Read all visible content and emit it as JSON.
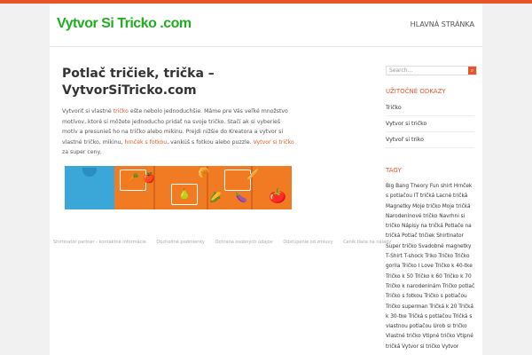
{
  "header": {
    "logo": "Vytvor Si Tricko .com",
    "nav_home": "HLAVNÁ STRÁNKA"
  },
  "main": {
    "title": "Potlač tričiek, trička – VytvorSiTricko.com",
    "paragraph": {
      "t1": "Vytvoriť si vlastné ",
      "l1": "tričko",
      "t2": " ešte nebolo jednoduchšie. Máme pre Vás veľké množstvo motívov, ktoré si môžete jednoducho pridať na svoje tričko. Stačí ak si vyberieš motív a presunieš ho na tričko alebo mikinu. Prejdi nižšie do Kreatora a vytvor si vlastné tričko, mikinu, ",
      "l2": "hrnček s fotkou",
      "t3": ", vankúš s fotkou alebo puzzle. ",
      "l3": "Vytvor si tričko",
      "t4": " za super ceny."
    },
    "footer_links": [
      "Shirtinator partner - kontaktné informácie",
      "Obchodné podmienky",
      "Ochrana osobných údajov",
      "Odstúpenie od zmluvy",
      "Ceník tlače na nálady"
    ]
  },
  "sidebar": {
    "search_placeholder": "Search...",
    "useful_links_title": "UŽITOČNÉ ODKAZY",
    "useful_links": [
      "Tričko",
      "Vytvor si tričko",
      "Vytvoř si triko"
    ],
    "tags_title": "TAGY",
    "tags": "Big Bang Theory Fun shirt Hrnček s potlačou IT tričká Lacné tričká Magnetky Moje tričko Moje tričká Narodeninové tričko Navrhni si tričko Nápisy na tričká Potlače na tričká Potlač tričiek Shirtinator Super tričko Svadobné magnetky T-Shirt T-shock Triko Tričko Tričko gorila Tričko I Love Tričko k 40-tke Tričko k 50 Tričko k 60 Tričko k 70 Tričko k narodeninám Tričko potlač Tričko s fotkou Tričko s potlačou Tričko superman Tričká k 20 Tričká k 30-tke Tričká s potlačou Tričká s vlastnou potlačou Urob si tričko Vlastné tričko Vtipné tričko Vtipné tričká Vytvor si tričko Vytvor"
  },
  "banner": {
    "vegetables": [
      "🥕",
      "🍎",
      "🥐",
      "🌽",
      "🍆",
      "🍅",
      "🥖",
      "🍐"
    ]
  }
}
